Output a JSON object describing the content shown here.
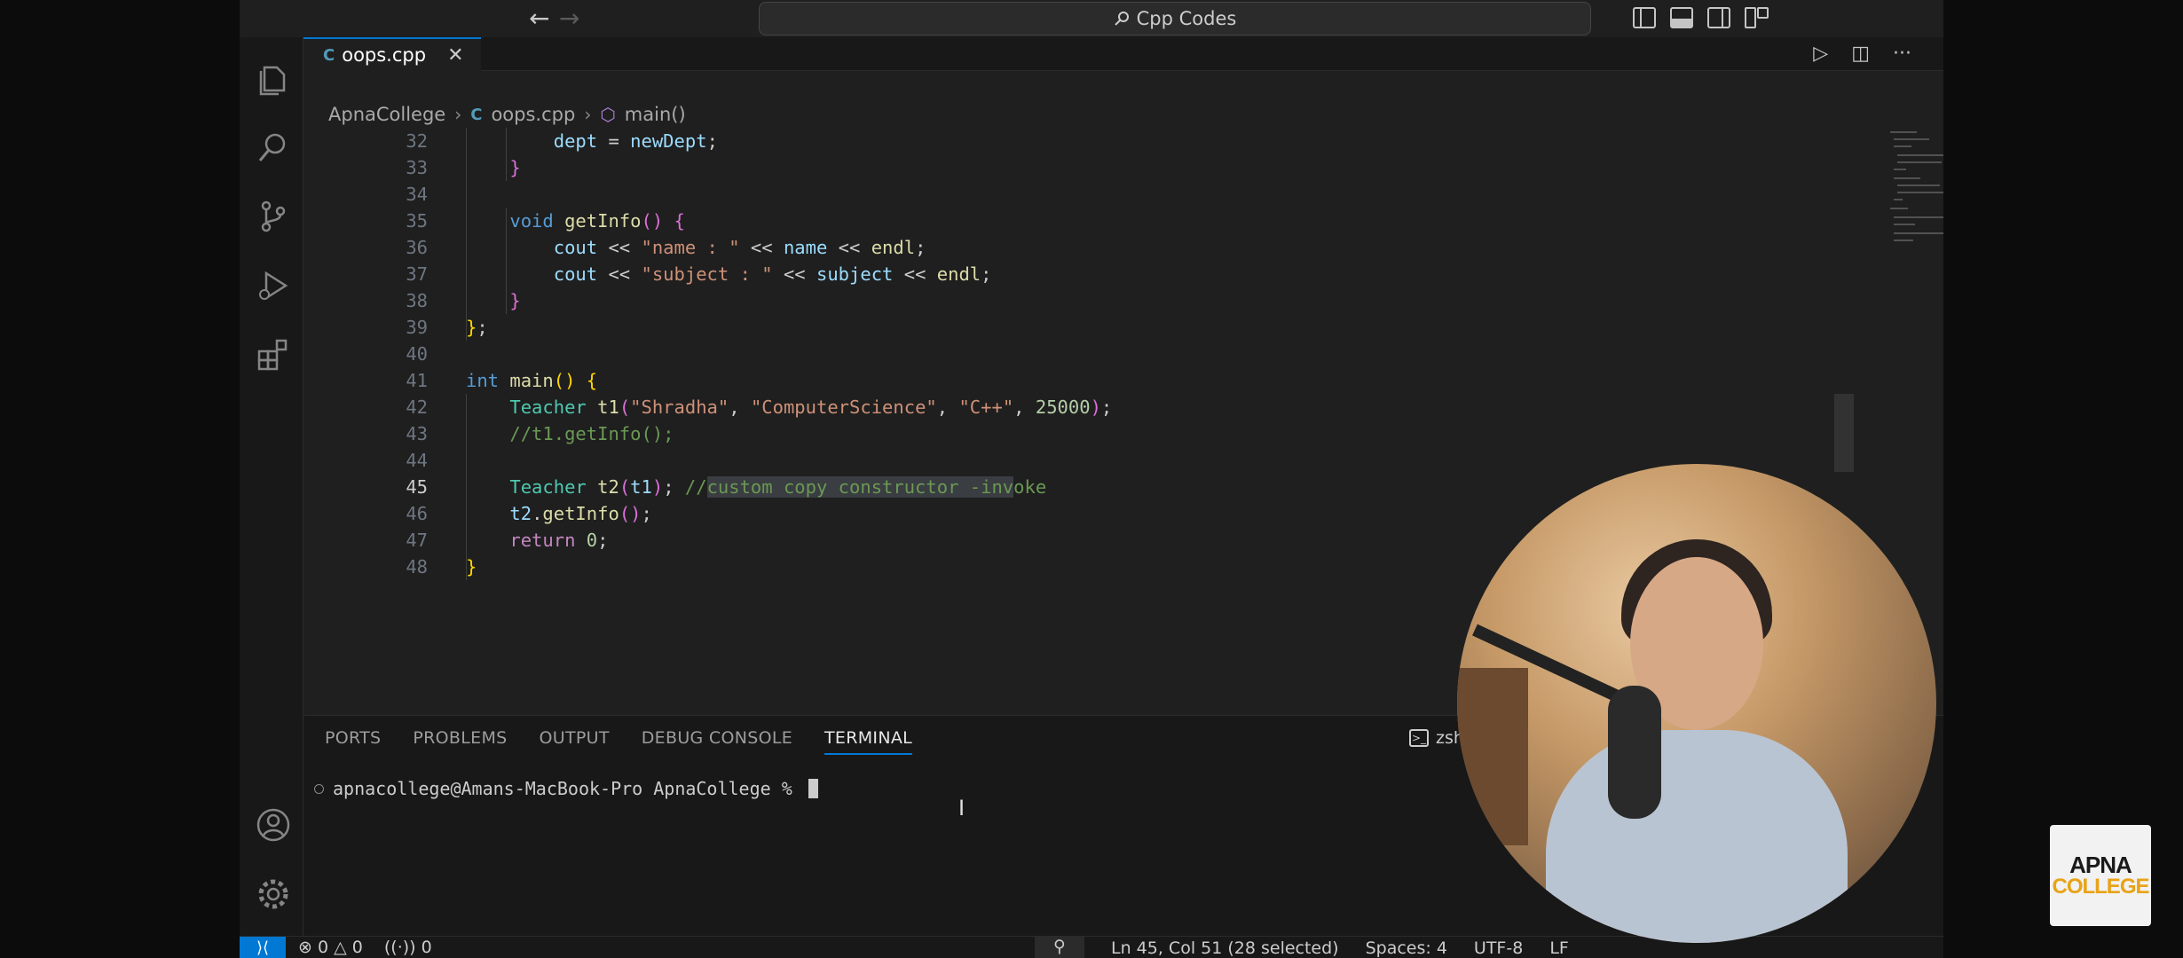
{
  "titlebar": {
    "back": "←",
    "forward": "→",
    "search_label": "Cpp Codes"
  },
  "tab": {
    "icon": "C",
    "label": "oops.cpp",
    "close": "✕"
  },
  "editor_actions": {
    "run": "▷",
    "split": "◫",
    "more": "···"
  },
  "breadcrumbs": {
    "folder": "ApnaCollege",
    "file": "oops.cpp",
    "symbol": "main()"
  },
  "code_lines": [
    {
      "n": "32",
      "t": "        dept = newDept;"
    },
    {
      "n": "33",
      "t": "    }"
    },
    {
      "n": "34",
      "t": ""
    },
    {
      "n": "35",
      "t": "    void getInfo() {"
    },
    {
      "n": "36",
      "t": "        cout << \"name : \" << name << endl;"
    },
    {
      "n": "37",
      "t": "        cout << \"subject : \" << subject << endl;"
    },
    {
      "n": "38",
      "t": "    }"
    },
    {
      "n": "39",
      "t": "};"
    },
    {
      "n": "40",
      "t": ""
    },
    {
      "n": "41",
      "t": "int main() {"
    },
    {
      "n": "42",
      "t": "    Teacher t1(\"Shradha\", \"ComputerScience\", \"C++\", 25000);"
    },
    {
      "n": "43",
      "t": "    //t1.getInfo();"
    },
    {
      "n": "44",
      "t": ""
    },
    {
      "n": "45",
      "t": "    Teacher t2(t1); //custom copy constructor -invoke"
    },
    {
      "n": "46",
      "t": "    t2.getInfo();"
    },
    {
      "n": "47",
      "t": "    return 0;"
    },
    {
      "n": "48",
      "t": "}"
    }
  ],
  "panel": {
    "tabs": [
      "PORTS",
      "PROBLEMS",
      "OUTPUT",
      "DEBUG CONSOLE",
      "TERMINAL"
    ],
    "active_tab": "TERMINAL",
    "terminal_name": "zsh - Apna",
    "prompt": "apnacollege@Amans-MacBook-Pro ApnaCollege %"
  },
  "statusbar": {
    "remote": "⟩⟨",
    "errors": "0",
    "warnings": "0",
    "ports": "0",
    "position": "Ln 45, Col 51 (28 selected)",
    "spaces": "Spaces: 4",
    "encoding": "UTF-8",
    "eol": "LF"
  },
  "logo": {
    "line1": "APNA",
    "line2": "COLLEGE"
  },
  "colors": {
    "accent": "#0078d4",
    "keyword": "#569cd6",
    "string": "#ce9178",
    "comment": "#6a9955",
    "function": "#dcdcaa",
    "type": "#4ec9b0",
    "logo_orange": "#e8a317"
  }
}
